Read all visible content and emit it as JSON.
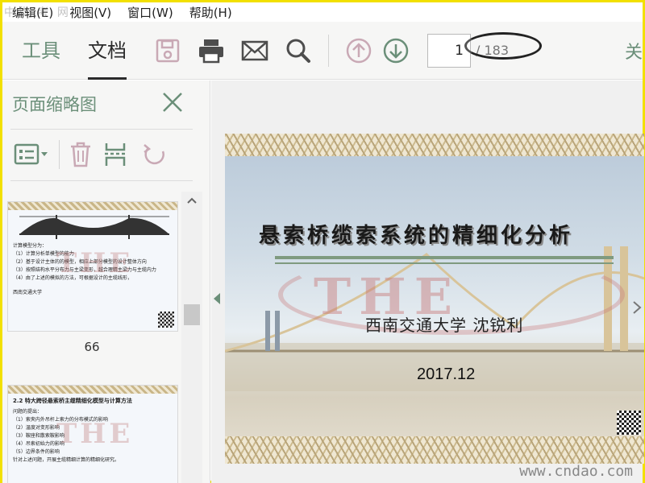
{
  "menu": [
    "编辑(E)",
    "视图(V)",
    "窗口(W)",
    "帮助(H)"
  ],
  "top_watermark": "中华 考 网",
  "toolbar": {
    "tab_tools": "工具",
    "tab_document": "文档",
    "page_current": "1",
    "page_total": "/ 183",
    "cut_glyph": "关"
  },
  "sidebar": {
    "title": "页面缩略图",
    "thumbnails": [
      {
        "page": "66",
        "lines": [
          "计算模型分为：",
          "（1）计算分析单模型的能力",
          "（2）基于设计主体的的模型，相应上部分模型的设计整体方向",
          "（3）按照结构水平分布力与主梁变形，越合理精主梁力与主缆内力",
          "（4）由了上述的模拟的方法，可根据设计的主缆线形，",
          "西南交通大学"
        ],
        "watermark": "THE"
      },
      {
        "page": "",
        "title": "2.2  特大跨径悬索桥主缆精细化模型与计算方法",
        "lines": [
          "问题的提出：",
          "（1）索夹内外吊杆上索力的分布模式的影响",
          "（2）温度对变形影响",
          "（3）鞍座和散索鞍影响",
          "（4）吊索初始力的影响",
          "（5）边界条件的影响",
          "针对上述问题，开展主缆精细计算的精细化研究。"
        ],
        "watermark": "THE"
      }
    ]
  },
  "slide": {
    "title": "悬索桥缆索系统的精细化分析",
    "author": "西南交通大学  沈锐利",
    "date": "2017.12",
    "watermark": "THE",
    "site_watermark": "www.cndao.com"
  },
  "colors": {
    "accent_green": "#6b8f79",
    "border_yellow": "#f2e000"
  }
}
